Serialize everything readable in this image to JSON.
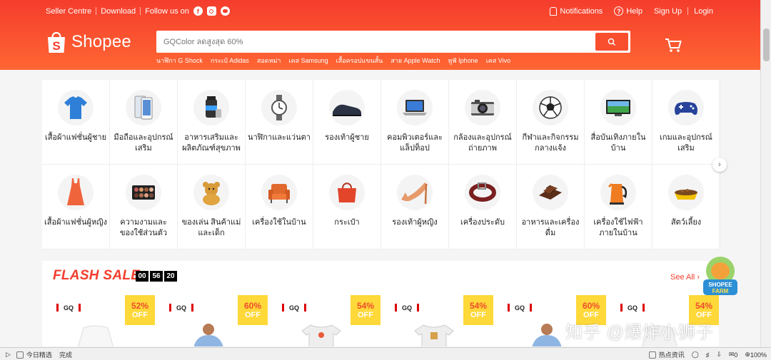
{
  "topnav": {
    "seller_centre": "Seller Centre",
    "download": "Download",
    "follow_us": "Follow us on",
    "notifications": "Notifications",
    "help": "Help",
    "sign_up": "Sign Up",
    "login": "Login"
  },
  "brand": {
    "name": "Shopee",
    "color": "#f53d2d"
  },
  "search": {
    "placeholder": "GQColor ลดสูงสุด 60%",
    "keywords": [
      "นาฬิกา G Shock",
      "กระเป๋ Adidas",
      "สอดหม่า",
      "เคส Samsung",
      "เสื้อครอปแขนสั้น",
      "สาย Apple Watch",
      "หูฟั Iphone",
      "เคส Vivo"
    ]
  },
  "categories": [
    {
      "label": "เสื้อผ้าแฟชั่นผู้ชาย",
      "icon": "shirt-icon"
    },
    {
      "label": "มือถือและอุปกรณ์เสริม",
      "icon": "phone-icon"
    },
    {
      "label": "อาหารเสริมและผลิตภัณฑ์สุขภาพ",
      "icon": "supplement-icon"
    },
    {
      "label": "นาฬิกาและแว่นตา",
      "icon": "watch-icon"
    },
    {
      "label": "รองเท้าผู้ชาย",
      "icon": "mens-shoe-icon"
    },
    {
      "label": "คอมพิวเตอร์และแล็ปท็อป",
      "icon": "laptop-icon"
    },
    {
      "label": "กล้องและอุปกรณ์ถ่ายภาพ",
      "icon": "camera-icon"
    },
    {
      "label": "กีฬาและกิจกรรมกลางแจ้ง",
      "icon": "football-icon"
    },
    {
      "label": "สื่อบันเทิงภายในบ้าน",
      "icon": "tv-icon"
    },
    {
      "label": "เกมและอุปกรณ์เสริม",
      "icon": "gamepad-icon"
    },
    {
      "label": "เสื้อผ้าแฟชั่นผู้หญิง",
      "icon": "dress-icon"
    },
    {
      "label": "ความงามและของใช้ส่วนตัว",
      "icon": "makeup-palette-icon"
    },
    {
      "label": "ของเล่น สินค้าแม่และเด็ก",
      "icon": "toy-bear-icon"
    },
    {
      "label": "เครื่องใช้ในบ้าน",
      "icon": "armchair-icon"
    },
    {
      "label": "กระเป๋า",
      "icon": "handbag-icon"
    },
    {
      "label": "รองเท้าผู้หญิง",
      "icon": "high-heel-icon"
    },
    {
      "label": "เครื่องประดับ",
      "icon": "belt-icon"
    },
    {
      "label": "อาหารและเครื่องดื่ม",
      "icon": "chocolate-icon"
    },
    {
      "label": "เครื่องใช้ไฟฟ้าภายในบ้าน",
      "icon": "kettle-icon"
    },
    {
      "label": "สัตว์เลี้ยง",
      "icon": "pet-bowl-icon"
    }
  ],
  "flash_sale": {
    "title": "FLASH SALE",
    "timer": [
      "00",
      "56",
      "20"
    ],
    "see_all": "See All",
    "items": [
      {
        "brand": "GQ",
        "discount": "52%",
        "off": "OFF"
      },
      {
        "brand": "GQ",
        "discount": "60%",
        "off": "OFF"
      },
      {
        "brand": "GQ",
        "discount": "54%",
        "off": "OFF"
      },
      {
        "brand": "GQ",
        "discount": "54%",
        "off": "OFF"
      },
      {
        "brand": "GQ",
        "discount": "60%",
        "off": "OFF"
      },
      {
        "brand": "GQ",
        "discount": "54%",
        "off": "OFF"
      }
    ]
  },
  "farm_badge": {
    "line1": "SHOPEE",
    "line2": "FARM"
  },
  "watermark": "知乎 @爆炸小狮子",
  "statusbar": {
    "left_label": "今日精选",
    "done": "完成",
    "hot_news": "热点资讯",
    "counter": "0",
    "zoom": "100%"
  }
}
